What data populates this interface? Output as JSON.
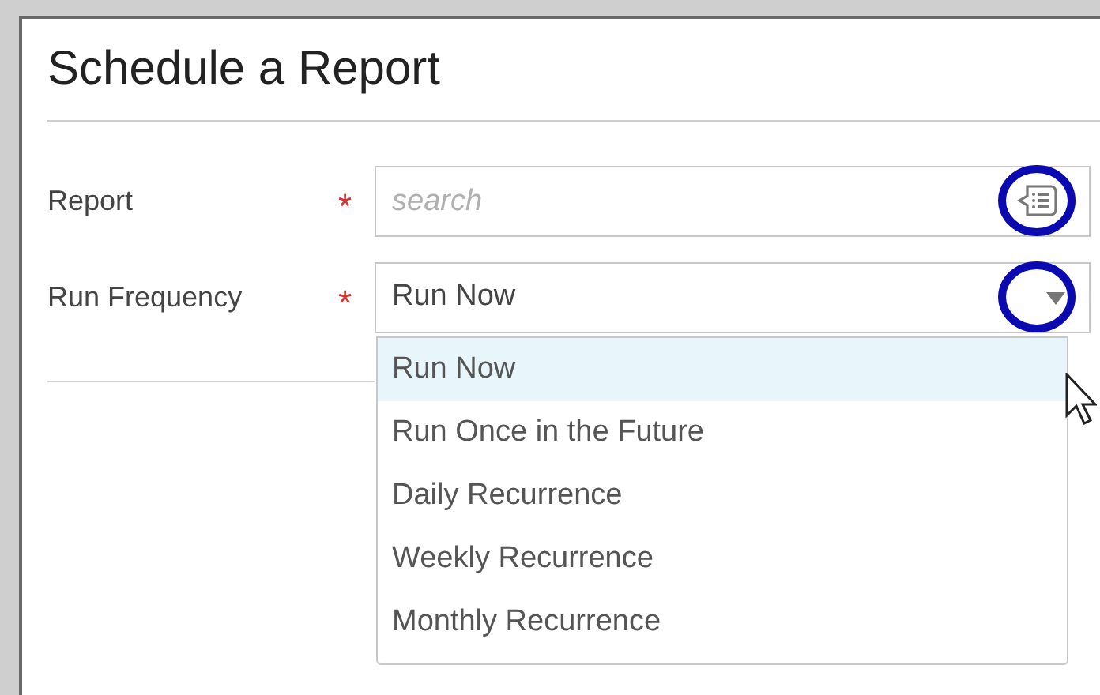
{
  "dialog": {
    "title": "Schedule a Report"
  },
  "fields": [
    {
      "kind": "search",
      "label": "Report",
      "required_mark": "*",
      "placeholder": "search"
    },
    {
      "kind": "select",
      "label": "Run Frequency",
      "required_mark": "*",
      "value": "Run Now",
      "expanded": true
    }
  ],
  "options": [
    {
      "label": "Run Now",
      "selected": true
    },
    {
      "label": "Run Once in the Future",
      "selected": false
    },
    {
      "label": "Daily Recurrence",
      "selected": false
    },
    {
      "label": "Weekly Recurrence",
      "selected": false
    },
    {
      "label": "Monthly Recurrence",
      "selected": false
    }
  ]
}
